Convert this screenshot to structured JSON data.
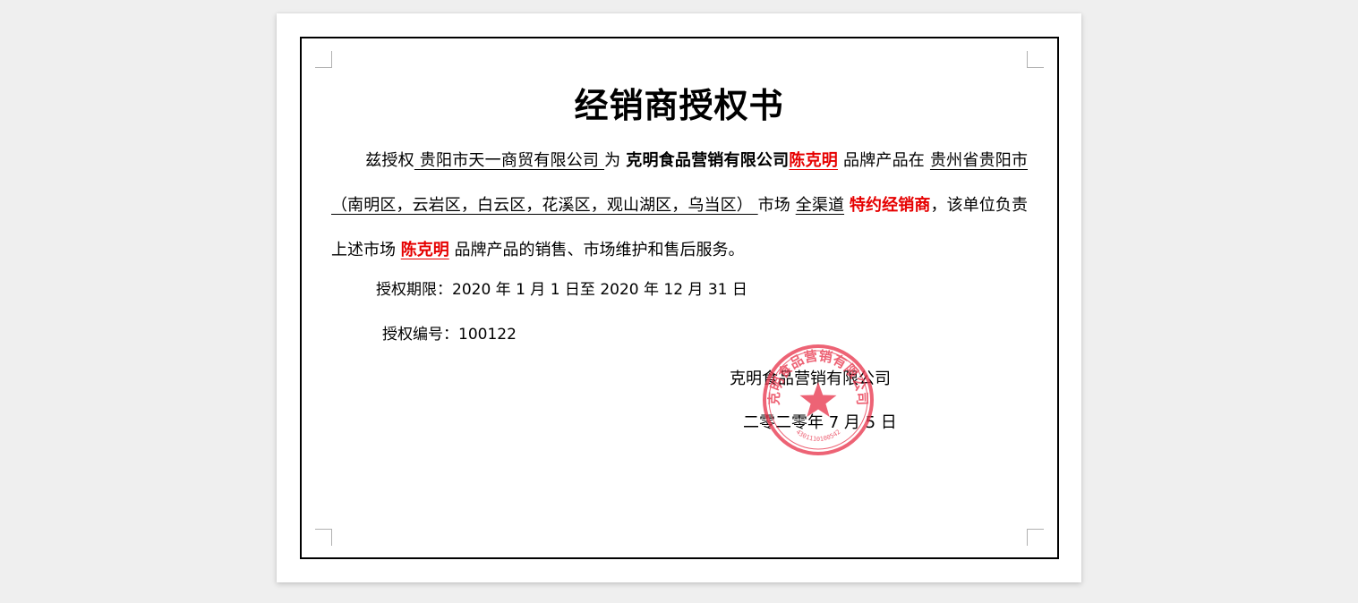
{
  "document": {
    "title": "经销商授权书",
    "body": {
      "p1": "兹授权",
      "authorized_party": " 贵阳市天一商贸有限公司 ",
      "p2": "为 ",
      "grantor": "克明食品营销有限公司",
      "brand": "陈克明",
      "p3": " 品牌产品在 ",
      "region": "贵州省贵阳市（南明区，云岩区，白云区，花溪区，观山湖区，乌当区） ",
      "p4": "市场 ",
      "channel": "全渠道",
      "dealer_type": "特约经销商",
      "p5": "，该单位负责上述市场 ",
      "brand_again": "陈克明",
      "p6": " 品牌产品的销售、市场维护和售后服务。"
    },
    "period": "授权期限：2020 年 1 月 1 日至 2020 年 12 月 31 日",
    "code": "授权编号：100122",
    "signature_company": "克明食品营销有限公司",
    "signature_date": "二零二零年 7 月 5 日",
    "seal": {
      "text": "克明食品营销有限公司",
      "number": "4301110100542",
      "color": "#e8384f"
    }
  }
}
